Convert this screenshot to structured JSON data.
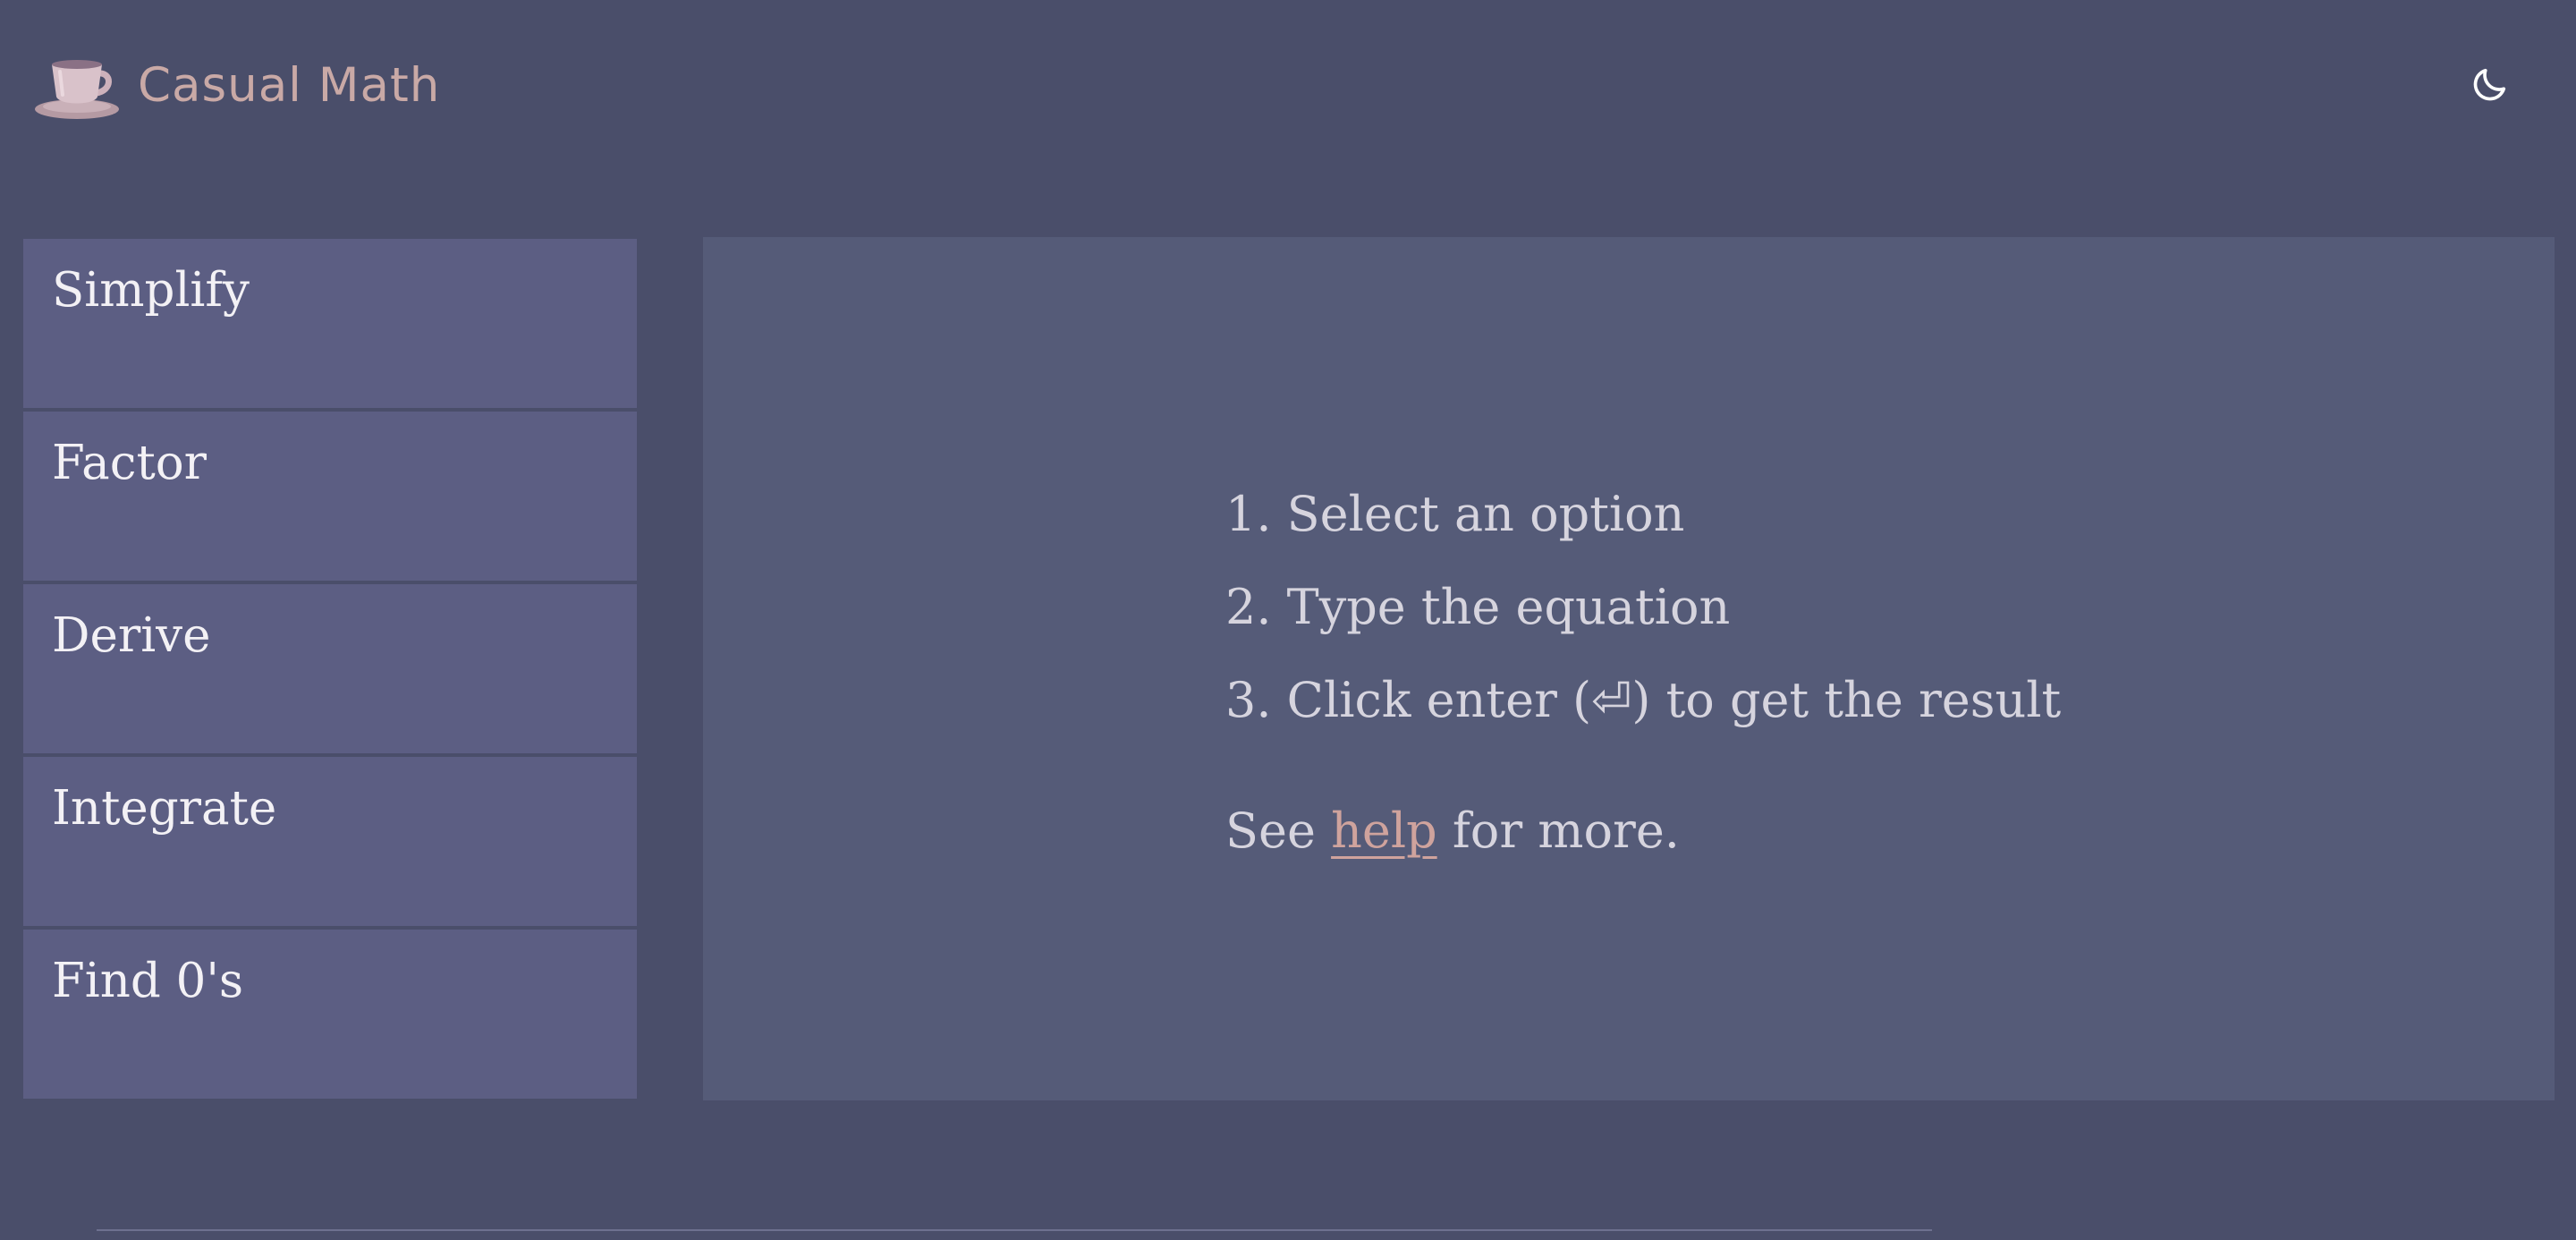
{
  "header": {
    "app_name": "Casual Math",
    "logo_icon": "teacup-icon",
    "theme_toggle_icon": "moon-icon"
  },
  "sidebar": {
    "options": [
      {
        "label": "Simplify"
      },
      {
        "label": "Factor"
      },
      {
        "label": "Derive"
      },
      {
        "label": "Integrate"
      },
      {
        "label": "Find 0's"
      }
    ]
  },
  "main": {
    "steps": [
      "1. Select an option",
      "2. Type the equation",
      "3. Click enter (⏎) to get the result"
    ],
    "help_prefix": "See ",
    "help_link": "help",
    "help_suffix": " for more."
  },
  "colors": {
    "background": "#4a4e6a",
    "option_background": "#5c5e83",
    "panel_background": "#555b78",
    "brand": "#c9a9a6",
    "link": "#cfa39d",
    "text": "#d6d4de"
  }
}
